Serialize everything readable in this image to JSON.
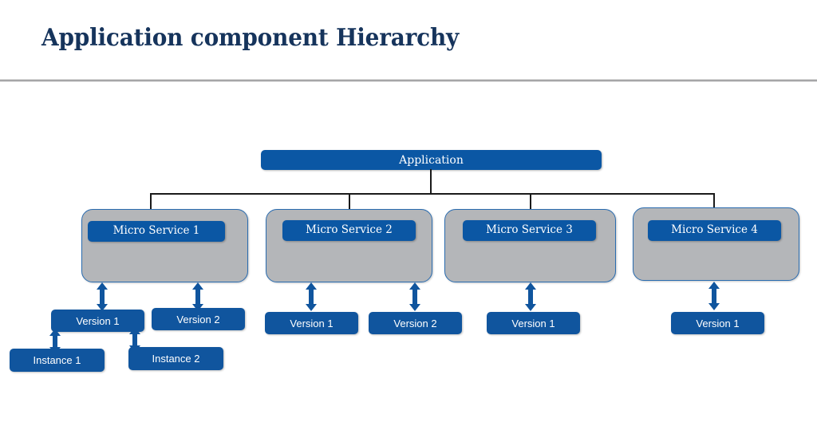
{
  "slide": {
    "title": "Application component Hierarchy",
    "colors": {
      "title": "#16345c",
      "node_blue": "#0b57a4",
      "leaf_blue": "#10559e",
      "container_gray": "#b4b6b9",
      "container_border": "#2a6cb0",
      "connector": "#1a1a1a",
      "rule": "#a6a6a8",
      "background": "#ffffff"
    }
  },
  "diagram": {
    "root": {
      "label": "Application"
    },
    "microservices": [
      {
        "label": "Micro Service 1",
        "versions": [
          {
            "label": "Version 1",
            "instances": [
              {
                "label": "Instance 1"
              },
              {
                "label": "Instance 2"
              }
            ]
          },
          {
            "label": "Version 2",
            "instances": []
          }
        ]
      },
      {
        "label": "Micro Service 2",
        "versions": [
          {
            "label": "Version 1",
            "instances": []
          },
          {
            "label": "Version 2",
            "instances": []
          }
        ]
      },
      {
        "label": "Micro Service 3",
        "versions": [
          {
            "label": "Version 1",
            "instances": []
          }
        ]
      },
      {
        "label": "Micro Service 4",
        "versions": [
          {
            "label": "Version 1",
            "instances": []
          }
        ]
      }
    ]
  }
}
